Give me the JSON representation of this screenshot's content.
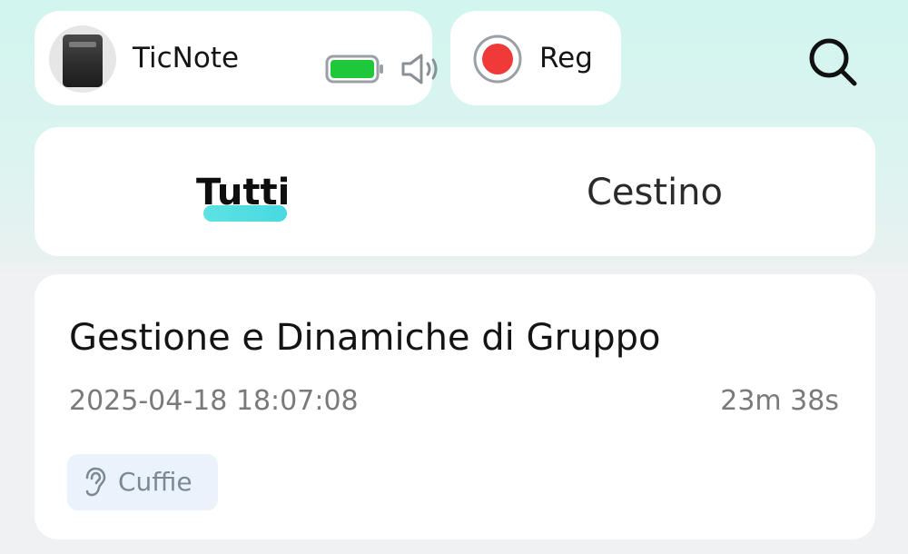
{
  "device": {
    "name": "TicNote",
    "battery_icon": "battery-full-icon",
    "volume_icon": "speaker-volume-icon",
    "battery_color": "#1fc83a"
  },
  "record": {
    "label": "Reg",
    "icon": "record-dot-icon",
    "dot_color": "#f03a3a"
  },
  "search": {
    "icon": "search-icon"
  },
  "tabs": [
    {
      "label": "Tutti",
      "active": true
    },
    {
      "label": "Cestino",
      "active": false
    }
  ],
  "accent_color": "#4fdfe2",
  "recordings": [
    {
      "title": "Gestione e Dinamiche di Gruppo",
      "datetime": "2025-04-18 18:07:08",
      "duration": "23m 38s",
      "source_icon": "ear-icon",
      "source_label": "Cuffie"
    }
  ]
}
